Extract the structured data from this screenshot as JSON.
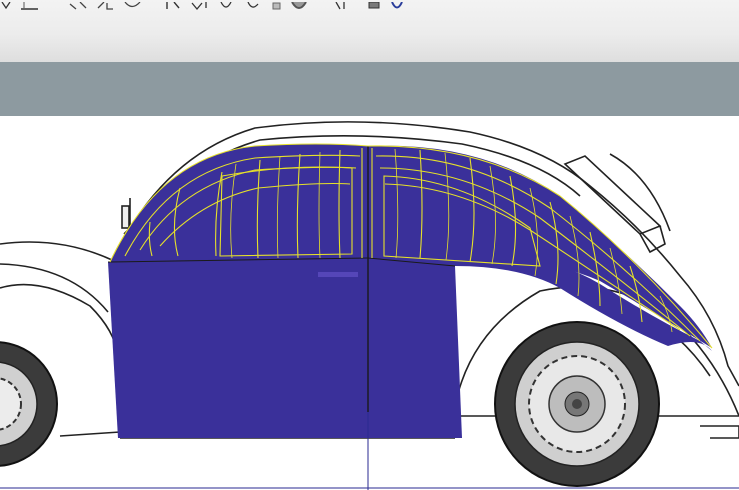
{
  "toolbar": {
    "icons": [
      "arrow-icon",
      "line-tool-icon",
      "undo-icon",
      "redo-icon",
      "rotate-icon",
      "fit-icon",
      "measure-icon",
      "snap-icon",
      "curve-icon",
      "point-icon",
      "render-icon",
      "view-icon",
      "zoom-icon",
      "help-icon"
    ]
  },
  "viewport": {
    "model": "beetle-body-surface",
    "surface_color": "#3a309a",
    "wire_color": "#e6e12a",
    "outline_color": "#222222"
  }
}
